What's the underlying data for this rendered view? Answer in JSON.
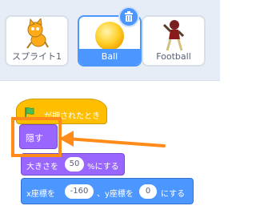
{
  "sprites": [
    {
      "name": "スプライト1",
      "icon": "cat-sprite-icon",
      "selected": false
    },
    {
      "name": "Ball",
      "icon": "ball-sprite-icon",
      "selected": true
    },
    {
      "name": "Football",
      "icon": "football-player-sprite-icon",
      "selected": false
    }
  ],
  "delete_icon": "trash-icon",
  "colors": {
    "events": "#ffbf00",
    "looks": "#9966ff",
    "motion": "#4c97ff",
    "highlight": "#ff8c1a",
    "selected": "#4c97ff"
  },
  "script": {
    "hat_label": "が押されたとき",
    "hide_label": "隠す",
    "size_prefix": "大きさを",
    "size_value": "50",
    "size_suffix": "%にする",
    "pos_x_label": "x座標を",
    "pos_x_value": "-160",
    "pos_y_label": "、y座標を",
    "pos_y_value": "0",
    "pos_suffix": "にする"
  }
}
